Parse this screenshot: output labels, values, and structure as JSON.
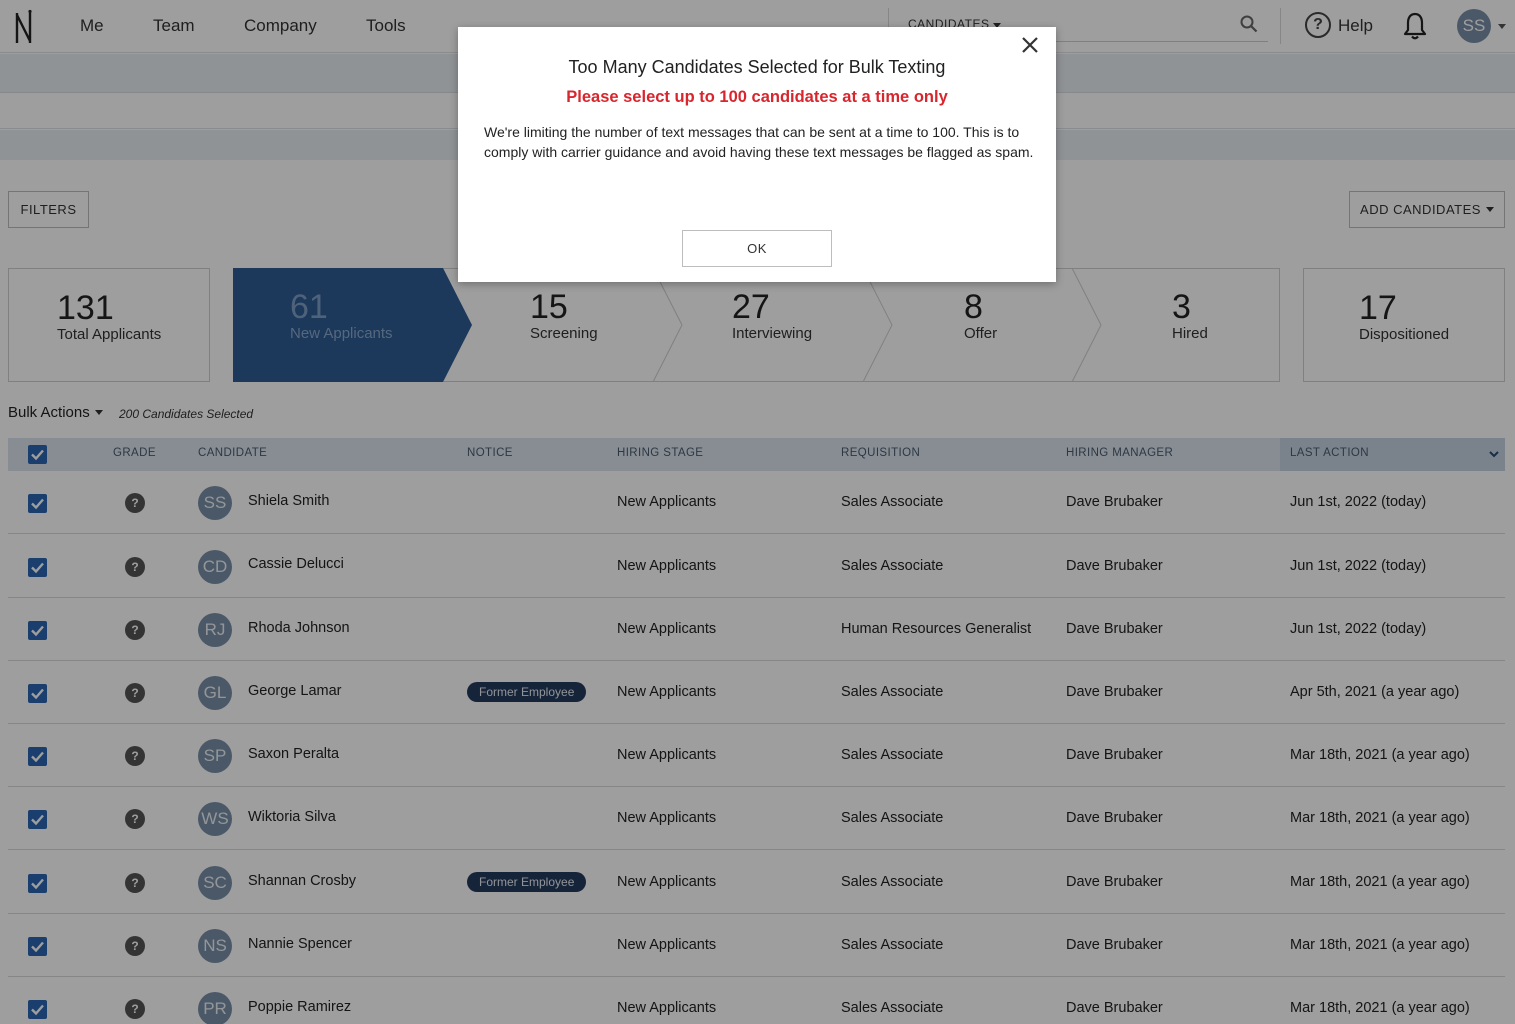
{
  "nav": {
    "items": [
      "Me",
      "Team",
      "Company",
      "Tools"
    ],
    "search_scope": "CANDIDATES",
    "help_label": "Help",
    "user_initials": "SS"
  },
  "toolbar": {
    "filters_label": "FILTERS",
    "add_candidates_label": "ADD CANDIDATES"
  },
  "pipeline": {
    "total": {
      "count": "131",
      "label": "Total Applicants"
    },
    "stages": [
      {
        "count": "61",
        "label": "New Applicants",
        "active": true
      },
      {
        "count": "15",
        "label": "Screening"
      },
      {
        "count": "27",
        "label": "Interviewing"
      },
      {
        "count": "8",
        "label": "Offer"
      },
      {
        "count": "3",
        "label": "Hired"
      }
    ],
    "dispositioned": {
      "count": "17",
      "label": "Dispositioned"
    }
  },
  "bulk": {
    "label": "Bulk Actions",
    "selected_text": "200 Candidates Selected"
  },
  "table": {
    "headers": {
      "grade": "GRADE",
      "candidate": "CANDIDATE",
      "notice": "NOTICE",
      "hiring_stage": "HIRING STAGE",
      "requisition": "REQUISITION",
      "hiring_manager": "HIRING MANAGER",
      "last_action": "LAST ACTION"
    },
    "grade_symbol": "?",
    "rows": [
      {
        "initials": "SS",
        "name": "Shiela Smith",
        "notice": "",
        "stage": "New Applicants",
        "requisition": "Sales Associate",
        "manager": "Dave Brubaker",
        "last_action": "Jun 1st, 2022 (today)"
      },
      {
        "initials": "CD",
        "name": "Cassie Delucci",
        "notice": "",
        "stage": "New Applicants",
        "requisition": "Sales Associate",
        "manager": "Dave Brubaker",
        "last_action": "Jun 1st, 2022 (today)"
      },
      {
        "initials": "RJ",
        "name": "Rhoda Johnson",
        "notice": "",
        "stage": "New Applicants",
        "requisition": "Human Resources Generalist",
        "manager": "Dave Brubaker",
        "last_action": "Jun 1st, 2022 (today)"
      },
      {
        "initials": "GL",
        "name": "George Lamar",
        "notice": "Former Employee",
        "stage": "New Applicants",
        "requisition": "Sales Associate",
        "manager": "Dave Brubaker",
        "last_action": "Apr 5th, 2021 (a year ago)"
      },
      {
        "initials": "SP",
        "name": "Saxon Peralta",
        "notice": "",
        "stage": "New Applicants",
        "requisition": "Sales Associate",
        "manager": "Dave Brubaker",
        "last_action": "Mar 18th, 2021 (a year ago)"
      },
      {
        "initials": "WS",
        "name": "Wiktoria Silva",
        "notice": "",
        "stage": "New Applicants",
        "requisition": "Sales Associate",
        "manager": "Dave Brubaker",
        "last_action": "Mar 18th, 2021 (a year ago)"
      },
      {
        "initials": "SC",
        "name": "Shannan Crosby",
        "notice": "Former Employee",
        "stage": "New Applicants",
        "requisition": "Sales Associate",
        "manager": "Dave Brubaker",
        "last_action": "Mar 18th, 2021 (a year ago)"
      },
      {
        "initials": "NS",
        "name": "Nannie Spencer",
        "notice": "",
        "stage": "New Applicants",
        "requisition": "Sales Associate",
        "manager": "Dave Brubaker",
        "last_action": "Mar 18th, 2021 (a year ago)"
      },
      {
        "initials": "PR",
        "name": "Poppie Ramirez",
        "notice": "",
        "stage": "New Applicants",
        "requisition": "Sales Associate",
        "manager": "Dave Brubaker",
        "last_action": "Mar 18th, 2021 (a year ago)"
      }
    ]
  },
  "modal": {
    "title": "Too Many Candidates Selected for Bulk Texting",
    "subtitle": "Please select up to 100 candidates at a time only",
    "body": "We're limiting the number of text messages that can be sent at a time to 100. This is to comply with carrier guidance and avoid having these text messages be flagged as spam.",
    "ok_label": "OK"
  },
  "colors": {
    "accent": "#2a65b0",
    "active_stage": "#2e5b94",
    "alert_red": "#d7262d",
    "badge_navy": "#243a5e"
  }
}
